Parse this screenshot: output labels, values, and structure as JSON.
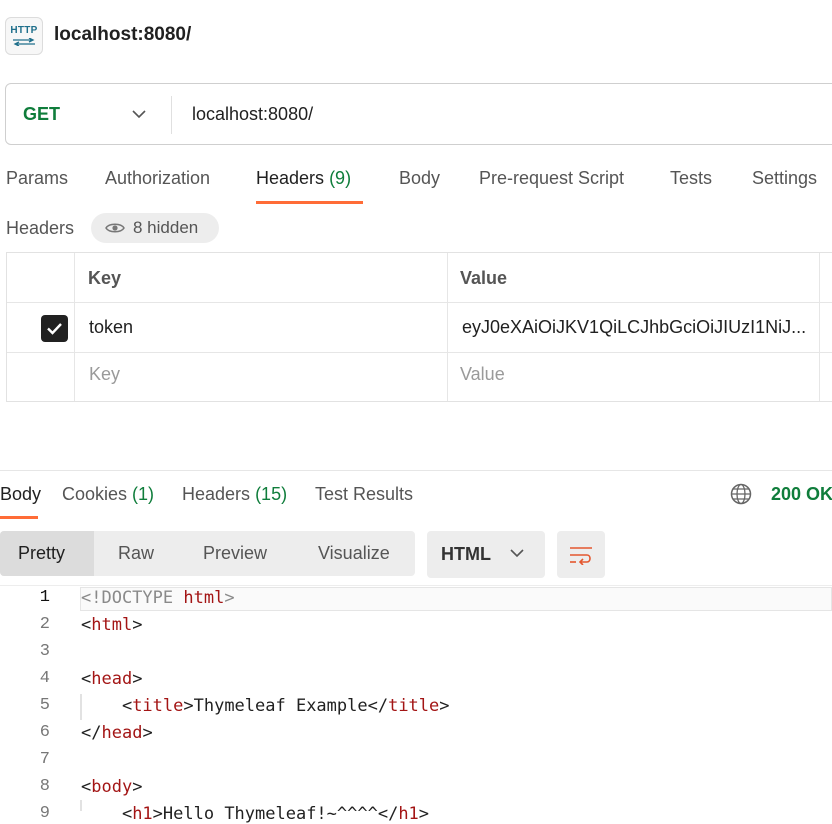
{
  "tab": {
    "badge_text": "HTTP",
    "title": "localhost:8080/"
  },
  "request": {
    "method": "GET",
    "url": "localhost:8080/"
  },
  "request_tabs": [
    {
      "label": "Params"
    },
    {
      "label": "Authorization"
    },
    {
      "label": "Headers",
      "count": "(9)"
    },
    {
      "label": "Body"
    },
    {
      "label": "Pre-request Script"
    },
    {
      "label": "Tests"
    },
    {
      "label": "Settings"
    }
  ],
  "headers_section": {
    "label": "Headers",
    "hidden_label": "8 hidden"
  },
  "headers_table": {
    "columns": [
      "Key",
      "Value"
    ],
    "rows": [
      {
        "checked": true,
        "key": "token",
        "value": "eyJ0eXAiOiJKV1QiLCJhbGciOiJIUzI1NiJ..."
      }
    ],
    "placeholder_key": "Key",
    "placeholder_value": "Value"
  },
  "response_tabs": [
    {
      "label": "Body"
    },
    {
      "label": "Cookies",
      "count": "(1)"
    },
    {
      "label": "Headers",
      "count": "(15)"
    },
    {
      "label": "Test Results"
    }
  ],
  "status": "200 OK",
  "view_modes": [
    "Pretty",
    "Raw",
    "Preview",
    "Visualize"
  ],
  "language": "HTML",
  "code_lines": [
    {
      "n": "1",
      "parts": [
        [
          "dim",
          "<!DOCTYPE "
        ],
        [
          "tag",
          "html"
        ],
        [
          "dim",
          ">"
        ]
      ]
    },
    {
      "n": "2",
      "parts": [
        [
          "",
          "<"
        ],
        [
          "tag",
          "html"
        ],
        [
          "",
          ">"
        ]
      ]
    },
    {
      "n": "3",
      "parts": []
    },
    {
      "n": "4",
      "parts": [
        [
          "",
          "<"
        ],
        [
          "tag",
          "head"
        ],
        [
          "",
          ">"
        ]
      ]
    },
    {
      "n": "5",
      "parts": [
        [
          "",
          "    <"
        ],
        [
          "tag",
          "title"
        ],
        [
          "",
          ">Thymeleaf Example</"
        ],
        [
          "tag",
          "title"
        ],
        [
          "",
          ">"
        ]
      ]
    },
    {
      "n": "6",
      "parts": [
        [
          "",
          "</"
        ],
        [
          "tag",
          "head"
        ],
        [
          "",
          ">"
        ]
      ]
    },
    {
      "n": "7",
      "parts": []
    },
    {
      "n": "8",
      "parts": [
        [
          "",
          "<"
        ],
        [
          "tag",
          "body"
        ],
        [
          "",
          ">"
        ]
      ]
    },
    {
      "n": "9",
      "parts": [
        [
          "",
          "    <"
        ],
        [
          "tag",
          "h1"
        ],
        [
          "",
          ">Hello Thymeleaf!~^^^^</"
        ],
        [
          "tag",
          "h1"
        ],
        [
          "",
          ">"
        ]
      ]
    }
  ],
  "colors": {
    "accent": "#ff6c37",
    "method_get": "#0f7d3b",
    "count_green": "#0f7d3b",
    "tag_red": "#a31515"
  }
}
